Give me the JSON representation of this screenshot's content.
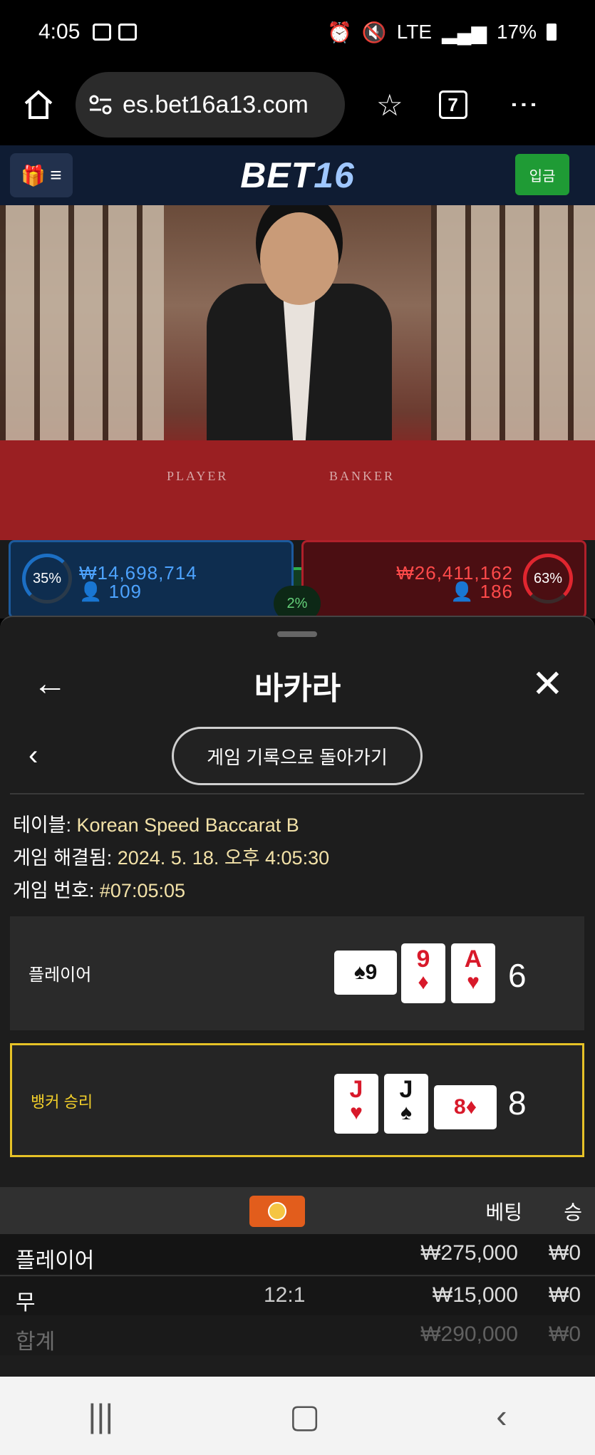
{
  "status": {
    "time": "4:05",
    "battery": "17%",
    "network": "LTE"
  },
  "browser": {
    "url": "es.bet16a13.com",
    "tab_count": "7"
  },
  "site": {
    "logo_main": "BET",
    "logo_accent": "16",
    "deposit_label": "입금"
  },
  "video": {
    "player_label": "PLAYER",
    "banker_label": "BANKER"
  },
  "stats": {
    "player_pct": "35%",
    "player_amount": "₩14,698,714",
    "player_count": "109",
    "banker_pct": "63%",
    "banker_amount": "₩26,411,162",
    "banker_count": "186",
    "tie_pct": "2%"
  },
  "sheet": {
    "title": "바카라",
    "return_button": "게임 기록으로 돌아가기",
    "table_label": "테이블:",
    "table_value": "Korean Speed Baccarat B",
    "resolved_label": "게임 해결됨:",
    "resolved_value": "2024. 5. 18. 오후 4:05:30",
    "game_no_label": "게임 번호:",
    "game_no_value": "#07:05:05",
    "player_hand": {
      "label": "플레이어",
      "score": "6",
      "cards": [
        {
          "r": "9",
          "s": "♠",
          "color": "black"
        },
        {
          "r": "9",
          "s": "♦",
          "color": "red"
        },
        {
          "r": "A",
          "s": "♥",
          "color": "red"
        }
      ]
    },
    "banker_hand": {
      "label": "뱅커 승리",
      "score": "8",
      "cards": [
        {
          "r": "J",
          "s": "♥",
          "color": "red"
        },
        {
          "r": "J",
          "s": "♠",
          "color": "black"
        },
        {
          "r": "8",
          "s": "♦",
          "color": "red"
        }
      ]
    },
    "table_headers": {
      "bet": "베팅",
      "win": "승"
    },
    "rows": [
      {
        "name": "플레이어",
        "odds": "",
        "bet": "₩275,000",
        "win": "₩0"
      },
      {
        "name": "무",
        "odds": "12:1",
        "bet": "₩15,000",
        "win": "₩0"
      },
      {
        "name": "합계",
        "odds": "",
        "bet": "₩290,000",
        "win": "₩0"
      }
    ]
  }
}
